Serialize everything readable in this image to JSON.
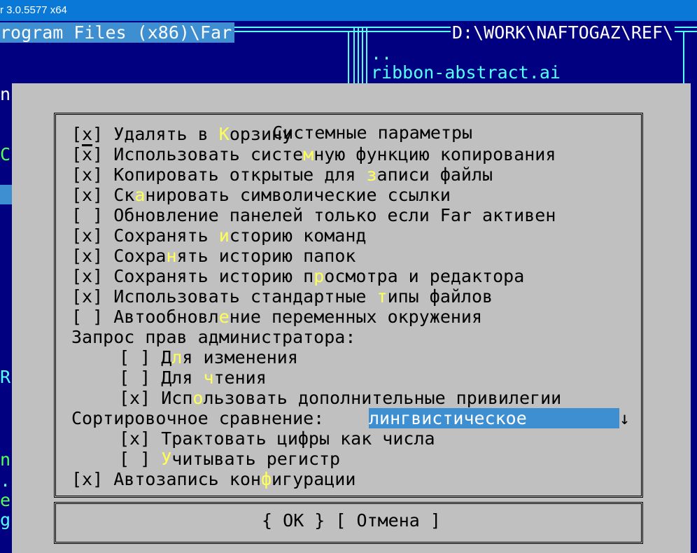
{
  "window": {
    "title": "r 3.0.5577 x64"
  },
  "left_panel": {
    "path": "rogram Files (x86)\\Far",
    "edge_chars": [
      "n",
      "C",
      "R",
      "n",
      ".",
      "e",
      "g"
    ]
  },
  "right_panel": {
    "path": "D:\\WORK\\NAFTOGAZ\\REF\\",
    "items": [
      "..",
      "ribbon-abstract.ai"
    ]
  },
  "dialog": {
    "title": "Системные параметры",
    "options": [
      {
        "mark": "[x]",
        "pre": "Удалять в ",
        "hot": "К",
        "post": "орзину"
      },
      {
        "mark": "[x]",
        "pre": "Использовать систе",
        "hot": "м",
        "post": "ную функцию копирования"
      },
      {
        "mark": "[x]",
        "pre": "Копировать открытые для ",
        "hot": "з",
        "post": "аписи файлы"
      },
      {
        "mark": "[x]",
        "pre": "Ск",
        "hot": "а",
        "post": "нировать символические ссылки"
      },
      {
        "mark": "[ ]",
        "pre": "Обновление панелей только если Far активен",
        "hot": "",
        "post": ""
      },
      {
        "mark": "[x]",
        "pre": "Сохранять ",
        "hot": "и",
        "post": "сторию команд"
      },
      {
        "mark": "[x]",
        "pre": "Сохра",
        "hot": "н",
        "post": "ять историю папок"
      },
      {
        "mark": "[x]",
        "pre": "Сохранять историю п",
        "hot": "р",
        "post": "осмотра и редактора"
      },
      {
        "mark": "[x]",
        "pre": "Использовать стандартные ",
        "hot": "т",
        "post": "ипы файлов"
      },
      {
        "mark": "[ ]",
        "pre": "Автообновл",
        "hot": "е",
        "post": "ние переменных окружения"
      }
    ],
    "admin_label": "Запрос прав администратора:",
    "admin_options": [
      {
        "mark": "[ ]",
        "pre": "Д",
        "hot": "л",
        "post": "я изменения"
      },
      {
        "mark": "[ ]",
        "pre": "Для ",
        "hot": "ч",
        "post": "тения"
      },
      {
        "mark": "[x]",
        "pre": "Исп",
        "hot": "о",
        "post": "льзовать дополнительные привилегии"
      }
    ],
    "sort_label": "Сортировочное сравнение:",
    "sort_value": "лингвистическое",
    "sort_arrow": "↓",
    "sort_options": [
      {
        "mark": "[x]",
        "pre": "Трактовать цифры как числа",
        "hot": "",
        "post": ""
      },
      {
        "mark": "[ ]",
        "pre": "",
        "hot": "У",
        "post": "читывать регистр"
      }
    ],
    "autosave": {
      "mark": "[x]",
      "pre": "Автозапись кон",
      "hot": "ф",
      "post": "игурации"
    },
    "ok_button": "{ OK }",
    "cancel_button": "[ Отмена ]"
  }
}
